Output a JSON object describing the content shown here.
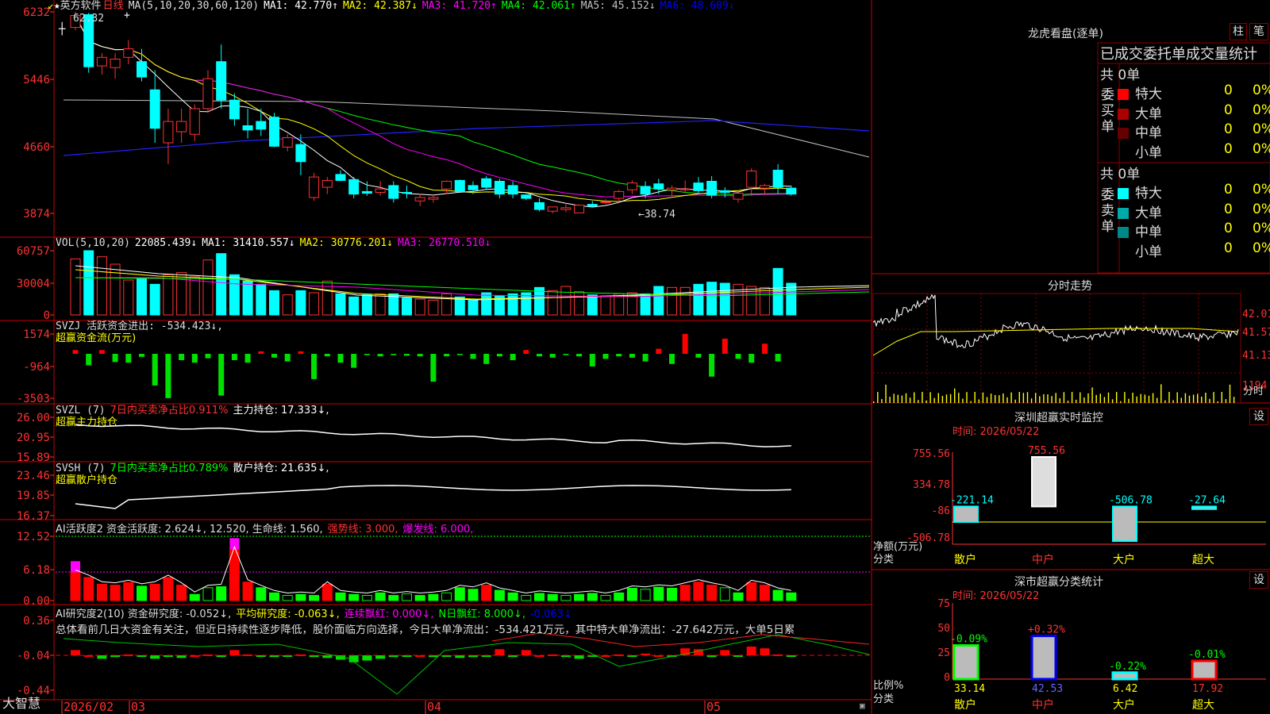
{
  "stock": {
    "name": "英方软件",
    "period": "日线",
    "star": "★"
  },
  "main_chart": {
    "ma_header": {
      "label": "MA(5,10,20,30,60,120)",
      "items": [
        {
          "text": "MA1: 42.770↑",
          "color": "#ffffff"
        },
        {
          "text": "MA2: 42.387↓",
          "color": "#ffff00"
        },
        {
          "text": "MA3: 41.720↑",
          "color": "#ff00ff"
        },
        {
          "text": "MA4: 42.061↑",
          "color": "#00ff00"
        },
        {
          "text": "MA5: 45.152↓",
          "color": "#c0c0c0"
        },
        {
          "text": "MA6: 48.609↓",
          "color": "#0000ff"
        }
      ]
    },
    "y_ticks": [
      "6232",
      "5446",
      "4660",
      "3874"
    ],
    "high_label": "62.32",
    "low_label": "38.74"
  },
  "volume_chart": {
    "header": {
      "label": "VOL(5,10,20)",
      "value": "22085.439↓",
      "items": [
        {
          "text": "MA1: 31410.557↓",
          "color": "#ffffff"
        },
        {
          "text": "MA2: 30776.201↓",
          "color": "#ffff00"
        },
        {
          "text": "MA3: 26770.510↓",
          "color": "#ff00ff"
        }
      ]
    },
    "y_ticks": [
      "60757",
      "30004",
      "0"
    ]
  },
  "svzj": {
    "header": "SVZJ  活跃资金进出: -534.423↓,",
    "sub": "超赢资金流(万元)",
    "y_ticks": [
      "1574",
      "-964",
      "-3503"
    ]
  },
  "svzl": {
    "header": "SVZL (7)",
    "pct": "7日内买卖净占比0.911%",
    "hold": "主力持仓: 17.333↓,",
    "sub": "超赢主力持仓",
    "y_ticks": [
      "26.00",
      "20.95",
      "15.89"
    ]
  },
  "svsh": {
    "header": "SVSH (7)",
    "pct": "7日内买卖净占比0.789%",
    "hold": "散户持仓: 21.635↓,",
    "sub": "超赢散户持仓",
    "y_ticks": [
      "23.46",
      "19.85",
      "16.37"
    ]
  },
  "ai_active": {
    "header": "AI活跃度2 资金活跃度: 2.624↓, 12.520, 生命线: 1.560,",
    "strong": "强势线: 3.000,",
    "burst": "爆发线: 6.000,",
    "y_ticks": [
      "12.52",
      "6.18",
      "0.00"
    ]
  },
  "ai_research": {
    "header": "AI研究度2(10) 资金研究度: -0.052↓,",
    "items": [
      {
        "text": "平均研究度: -0.063↓,",
        "color": "#ffff00"
      },
      {
        "text": "连续飘红: 0.000↓,",
        "color": "#ff00ff"
      },
      {
        "text": "N日飘红: 8.000↓,",
        "color": "#00ff00"
      },
      {
        "text": "-0.063↓",
        "color": "#0000ff"
      }
    ],
    "summary": "总体看前几日大资金有关注，但近日持续性逐步降低，股价面临方向选择，今日大单净流出：-534.421万元，其中特大单净流出：-27.642万元，大单5日累",
    "y_ticks": [
      "0.36",
      "-0.04",
      "-0.44"
    ]
  },
  "x_axis": {
    "labels": [
      "2026/02",
      "03",
      "04",
      "05"
    ],
    "brand": "大智慧"
  },
  "dragon_tiger": {
    "title": "龙虎看盘(逐单)",
    "btn_zhu": "柱",
    "btn_bi": "笔",
    "tabs": [
      "已成交",
      "委托单",
      "成交量统计"
    ],
    "buy_label": "委买单",
    "sell_label": "委卖单",
    "buy_total": "共 0单",
    "sell_total": "共 0单",
    "buy_rows": [
      {
        "label": "特大",
        "count": "0",
        "pct": "0%",
        "color": "#ff0000"
      },
      {
        "label": "大单",
        "count": "0",
        "pct": "0%",
        "color": "#aa0000"
      },
      {
        "label": "中单",
        "count": "0",
        "pct": "0%",
        "color": "#660000"
      },
      {
        "label": "小单",
        "count": "0",
        "pct": "0%",
        "color": ""
      }
    ],
    "sell_rows": [
      {
        "label": "特大",
        "count": "0",
        "pct": "0%",
        "color": "#00ffff"
      },
      {
        "label": "大单",
        "count": "0",
        "pct": "0%",
        "color": "#00aaaa"
      },
      {
        "label": "中单",
        "count": "0",
        "pct": "0%",
        "color": "#008888"
      },
      {
        "label": "小单",
        "count": "0",
        "pct": "0%",
        "color": ""
      }
    ]
  },
  "intraday": {
    "title": "分时走势",
    "y_ticks": [
      "42.01",
      "41.57",
      "41.13"
    ],
    "vol_tick": "1194",
    "fen_label": "分时"
  },
  "sz_monitor": {
    "title": "深圳超赢实时监控",
    "btn": "设",
    "time": "时间: 2026/05/22",
    "y_ticks": [
      "755.56",
      "334.78",
      "-86",
      "-506.78"
    ],
    "axis_label": "净额(万元)",
    "cat_label": "分类",
    "chart_data": {
      "type": "bar",
      "categories": [
        "散户",
        "中户",
        "大户",
        "超大"
      ],
      "values": [
        -221.14,
        755.56,
        -506.78,
        -27.64
      ],
      "ylim": [
        -506.78,
        755.56
      ]
    }
  },
  "sz_classify": {
    "title": "深市超赢分类统计",
    "btn": "设",
    "time": "时间: 2026/05/22",
    "y_ticks": [
      "75",
      "50",
      "25",
      "0"
    ],
    "axis_label": "比例%",
    "cat_label": "分类",
    "chart_data": {
      "type": "bar",
      "categories": [
        "散户",
        "中户",
        "大户",
        "超大"
      ],
      "series": [
        {
          "values": [
            33.14,
            42.53,
            6.42,
            17.92
          ]
        },
        {
          "values": [
            -0.09,
            0.32,
            -0.22,
            -0.01
          ]
        }
      ],
      "ylim": [
        0,
        75
      ]
    }
  },
  "chart_data": [
    {
      "type": "candlestick",
      "title": "英方软件 日线",
      "ohlc": [
        [
          60.5,
          62.32,
          60.2,
          61.9
        ],
        [
          62.0,
          62.2,
          55.2,
          55.9
        ],
        [
          56.0,
          57.5,
          55.0,
          57.0
        ],
        [
          55.8,
          57.5,
          54.5,
          56.8
        ],
        [
          57.0,
          59.0,
          56.2,
          58.0
        ],
        [
          56.5,
          58.0,
          54.2,
          54.7
        ],
        [
          53.2,
          55.5,
          47.0,
          48.7
        ],
        [
          47.0,
          51.0,
          44.5,
          49.5
        ],
        [
          48.3,
          51.0,
          47.0,
          49.5
        ],
        [
          48.0,
          51.5,
          47.2,
          51.0
        ],
        [
          51.0,
          55.5,
          50.5,
          54.5
        ],
        [
          56.5,
          58.5,
          51.0,
          52.0
        ],
        [
          52.0,
          52.8,
          49.0,
          49.8
        ],
        [
          49.0,
          51.0,
          47.5,
          48.5
        ],
        [
          49.5,
          51.0,
          47.8,
          48.6
        ],
        [
          50.0,
          50.5,
          46.5,
          46.6
        ],
        [
          46.5,
          48.0,
          46.0,
          47.6
        ],
        [
          46.8,
          48.0,
          43.2,
          44.8
        ],
        [
          40.6,
          43.5,
          40.2,
          43.0
        ],
        [
          41.8,
          43.0,
          41.0,
          42.6
        ],
        [
          43.3,
          43.8,
          42.5,
          42.6
        ],
        [
          42.7,
          43.0,
          40.5,
          41.0
        ],
        [
          41.3,
          42.5,
          40.8,
          41.1
        ],
        [
          41.2,
          42.5,
          40.8,
          41.6
        ],
        [
          42.0,
          42.5,
          40.0,
          40.5
        ],
        [
          41.2,
          42.0,
          40.5,
          41.1
        ],
        [
          40.2,
          41.0,
          39.6,
          40.6
        ],
        [
          40.4,
          41.0,
          40.0,
          40.6
        ],
        [
          41.6,
          42.6,
          41.0,
          42.5
        ],
        [
          42.6,
          42.7,
          41.3,
          41.3
        ],
        [
          42.0,
          42.5,
          41.0,
          41.5
        ],
        [
          42.8,
          43.1,
          41.5,
          41.8
        ],
        [
          42.5,
          42.8,
          40.5,
          41.0
        ],
        [
          42.0,
          42.5,
          40.5,
          41.0
        ],
        [
          40.9,
          41.0,
          40.3,
          40.5
        ],
        [
          40.0,
          40.5,
          39.0,
          39.2
        ],
        [
          39.0,
          39.5,
          38.74,
          39.5
        ],
        [
          39.2,
          40.0,
          38.9,
          39.4
        ],
        [
          38.8,
          39.8,
          38.8,
          39.7
        ],
        [
          39.8,
          40.2,
          39.5,
          39.6
        ],
        [
          40.0,
          40.4,
          39.8,
          40.1
        ],
        [
          40.5,
          41.5,
          40.0,
          41.3
        ],
        [
          41.5,
          42.6,
          41.0,
          42.3
        ],
        [
          41.9,
          42.5,
          40.5,
          41.0
        ],
        [
          42.2,
          42.8,
          41.0,
          41.6
        ],
        [
          41.5,
          42.0,
          40.8,
          41.7
        ],
        [
          41.5,
          42.6,
          41.2,
          41.6
        ],
        [
          42.3,
          43.0,
          41.0,
          41.4
        ],
        [
          42.5,
          43.1,
          40.5,
          40.9
        ],
        [
          41.4,
          41.8,
          40.6,
          41.2
        ],
        [
          40.4,
          41.0,
          40.0,
          41.1
        ],
        [
          41.8,
          44.0,
          40.8,
          43.7
        ],
        [
          41.7,
          42.2,
          41.0,
          42.0
        ],
        [
          43.8,
          44.5,
          41.0,
          41.8
        ],
        [
          41.7,
          42.0,
          40.8,
          41.0
        ]
      ]
    },
    {
      "type": "bar",
      "title": "VOL(5,10,20)",
      "values": [
        53000,
        60757,
        55000,
        48000,
        33000,
        35000,
        29000,
        38000,
        40000,
        36000,
        52000,
        58000,
        38000,
        32000,
        29000,
        23000,
        19000,
        23000,
        21000,
        32000,
        20000,
        17000,
        19000,
        20000,
        20000,
        16000,
        15000,
        14000,
        20000,
        17000,
        14000,
        21000,
        18000,
        20000,
        21000,
        26000,
        23000,
        27000,
        22000,
        19000,
        18000,
        20000,
        21000,
        20000,
        27000,
        26000,
        26000,
        29000,
        31000,
        30000,
        29000,
        27000,
        26000,
        44000,
        30000,
        22085
      ]
    },
    {
      "type": "bar",
      "title": "超赢资金流(万元)",
      "values": [
        300,
        -900,
        300,
        -650,
        -700,
        -240,
        -2500,
        -3503,
        -500,
        -700,
        -350,
        -3300,
        -500,
        -700,
        200,
        -300,
        -600,
        200,
        -2000,
        -200,
        -700,
        -1100,
        -100,
        -200,
        -100,
        -150,
        -200,
        -2200,
        -200,
        -100,
        -400,
        -800,
        -200,
        -500,
        300,
        -200,
        -300,
        -100,
        -200,
        -1000,
        -400,
        -200,
        -300,
        -600,
        400,
        -800,
        1574,
        -300,
        -1800,
        1200,
        -400,
        -700,
        800,
        -600
      ]
    },
    {
      "type": "line",
      "title": "超赢主力持仓",
      "ylim": [
        15.89,
        26.0
      ]
    },
    {
      "type": "line",
      "title": "超赢散户持仓",
      "ylim": [
        16.37,
        23.46
      ]
    },
    {
      "type": "bar",
      "title": "AI活跃度2",
      "ylim": [
        0,
        12.52
      ]
    },
    {
      "type": "line",
      "title": "AI研究度2(10)",
      "ylim": [
        -0.44,
        0.36
      ]
    }
  ]
}
